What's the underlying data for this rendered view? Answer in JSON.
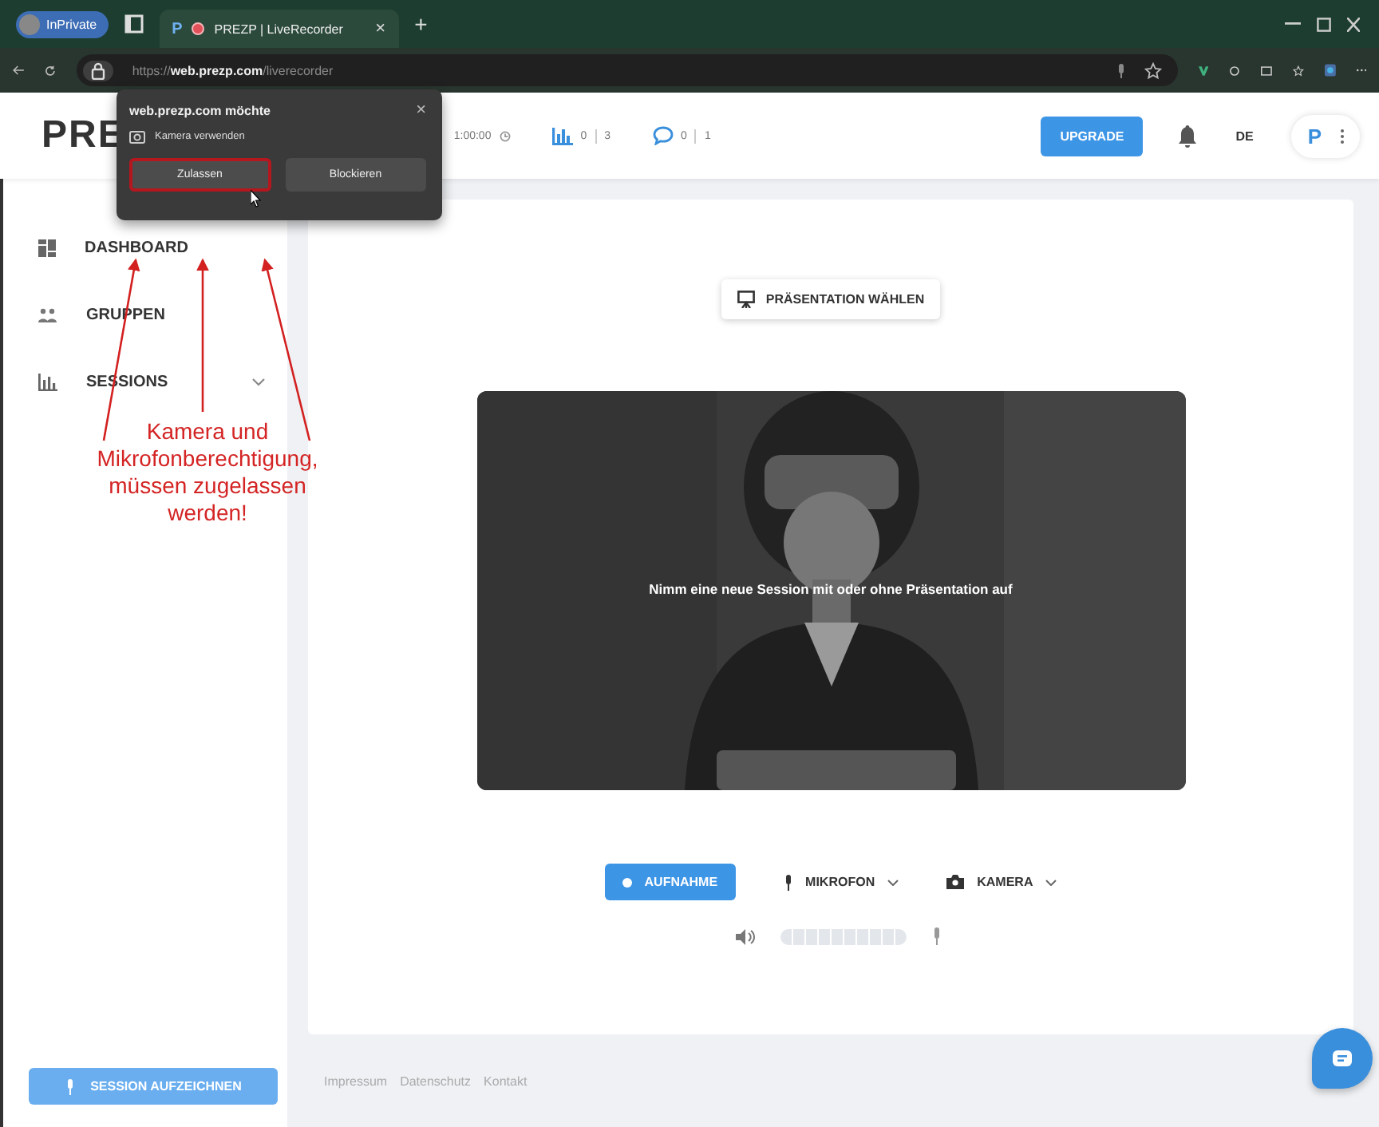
{
  "browser": {
    "profile": "InPrivate",
    "tab_logo": "P",
    "tab_title": "PREZP | LiveRecorder",
    "tab_close": "×",
    "new_tab": "+",
    "address": "https://**web.prezp.com**/liverecorder"
  },
  "permission_popup": {
    "title": "web.prezp.com möchte",
    "close": "×",
    "permission": "Kamera verwenden",
    "buttons": [
      {
        "label": "Zulassen",
        "highlighted": true
      },
      {
        "label": "Blockieren",
        "highlighted": false
      }
    ]
  },
  "header": {
    "logo": "PRE",
    "timer": "1:00:00",
    "stats": [
      {
        "kind": "chart",
        "values": [
          "0",
          "3"
        ]
      },
      {
        "kind": "chat",
        "values": [
          "0",
          "1"
        ]
      }
    ],
    "upgrade": "UPGRADE",
    "language": "DE",
    "profile_logo": "P"
  },
  "sidebar": {
    "items": [
      {
        "label": "DASHBOARD",
        "kind": "dashboard"
      },
      {
        "label": "GRUPPEN",
        "kind": "groups"
      },
      {
        "label": "SESSIONS",
        "kind": "sessions"
      }
    ],
    "record_button": "SESSION AUFZEICHNEN"
  },
  "main": {
    "choose_presentation": "PRÄSENTATION WÄHLEN",
    "video_caption": "Nimm eine neue Session mit oder ohne Präsentation auf",
    "controls": [
      {
        "label": "AUFNAHME",
        "kind": "record"
      },
      {
        "label": "MIKROFON",
        "kind": "mic"
      },
      {
        "label": "KAMERA",
        "kind": "camera"
      }
    ],
    "mic_meter": {
      "level": 0
    }
  },
  "footer": {
    "links": [
      "Impressum",
      "Datenschutz",
      "Kontakt"
    ]
  },
  "annotation": {
    "text": "Kamera und Mikrofonberechtigung, müssen zugelassen werden!"
  }
}
